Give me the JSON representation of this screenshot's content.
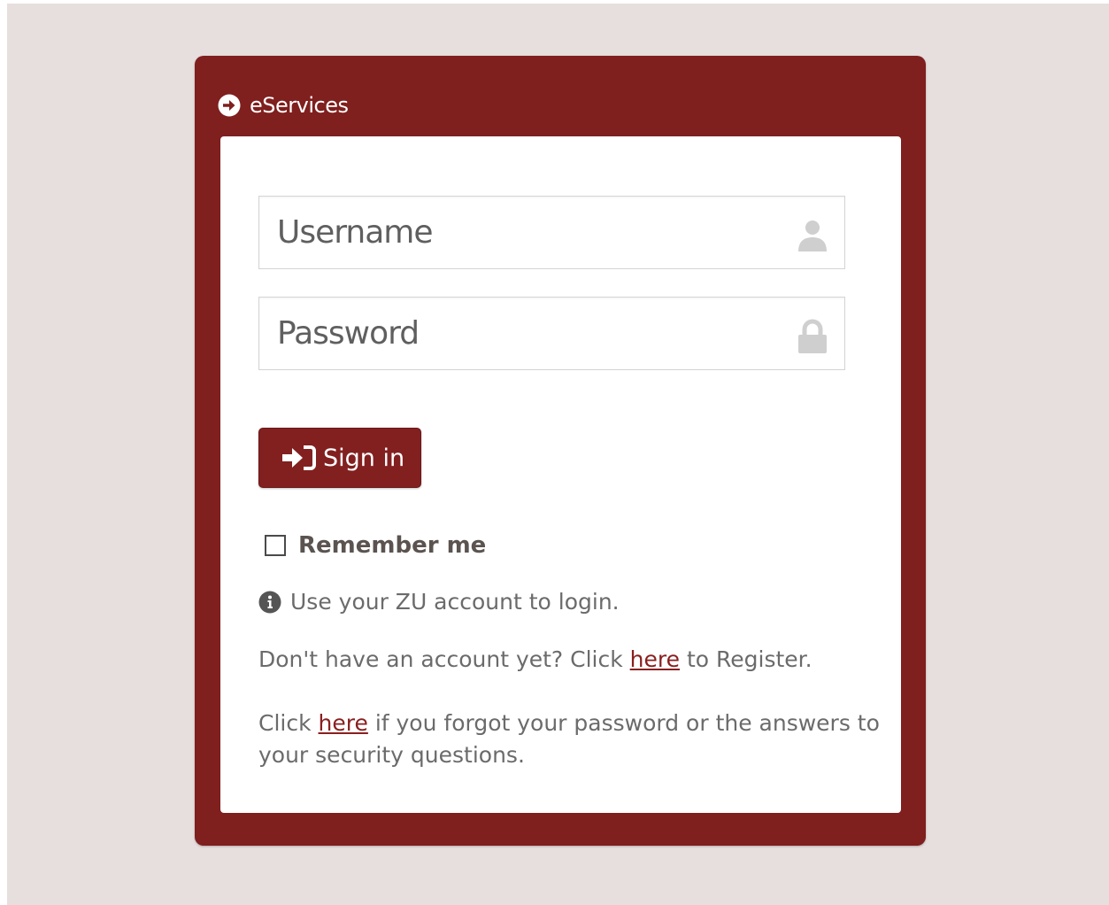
{
  "header": {
    "title": "eServices",
    "icon": "arrow-circle-right-icon"
  },
  "form": {
    "username_placeholder": "Username",
    "password_placeholder": "Password",
    "username_icon": "user-icon",
    "password_icon": "lock-icon",
    "signin_label": "Sign in",
    "signin_icon": "sign-in-icon",
    "remember_label": "Remember me",
    "remember_checked": false
  },
  "info": {
    "icon": "info-icon",
    "text": "Use your ZU account to login."
  },
  "register": {
    "before": "Don't have an account yet? Click ",
    "link": "here",
    "after": " to Register."
  },
  "forgot": {
    "before": "Click ",
    "link": "here",
    "after": " if you forgot your password or the answers to your security questions."
  },
  "colors": {
    "brand": "#7f1f1e",
    "background": "#e7dfdd",
    "link": "#8a1f1f"
  }
}
